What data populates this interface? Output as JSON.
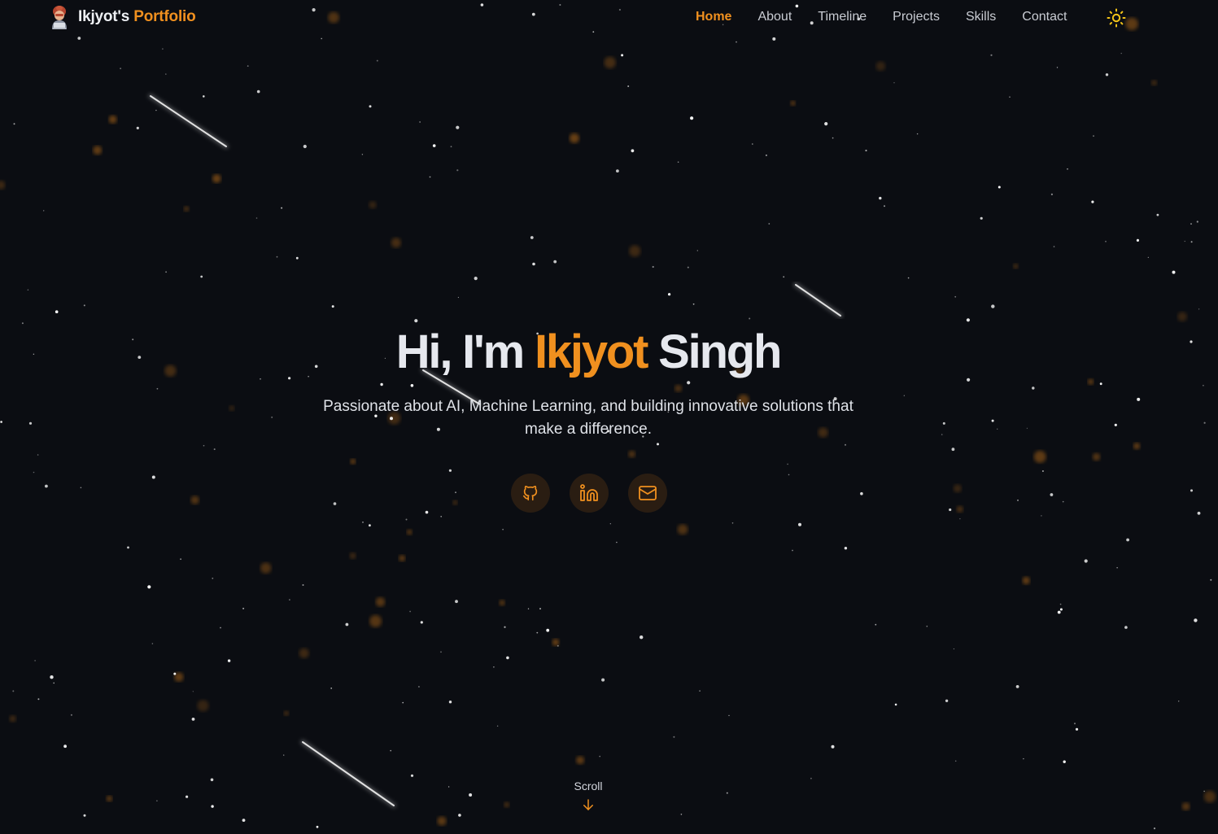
{
  "brand": {
    "name": "Ikjyot's",
    "accent": "Portfolio",
    "avatar_icon": "person-avatar-icon"
  },
  "nav": {
    "items": [
      {
        "label": "Home",
        "active": true
      },
      {
        "label": "About",
        "active": false
      },
      {
        "label": "Timeline",
        "active": false
      },
      {
        "label": "Projects",
        "active": false
      },
      {
        "label": "Skills",
        "active": false
      },
      {
        "label": "Contact",
        "active": false
      }
    ],
    "theme_toggle_icon": "sun-icon"
  },
  "hero": {
    "greeting": "Hi, I'm",
    "first_name": "Ikjyot",
    "last_name": "Singh",
    "subtitle": "Passionate about AI, Machine Learning, and building innovative solutions that make a difference.",
    "social": [
      {
        "icon": "github-icon"
      },
      {
        "icon": "linkedin-icon"
      },
      {
        "icon": "mail-icon"
      }
    ]
  },
  "scroll": {
    "label": "Scroll",
    "icon": "arrow-down-icon"
  },
  "colors": {
    "background": "#0b0d12",
    "accent": "#f0901f",
    "text": "#e6e8ee",
    "muted": "#c9ccd3",
    "social_bg": "#2a1d12",
    "sun": "#f5c518"
  }
}
